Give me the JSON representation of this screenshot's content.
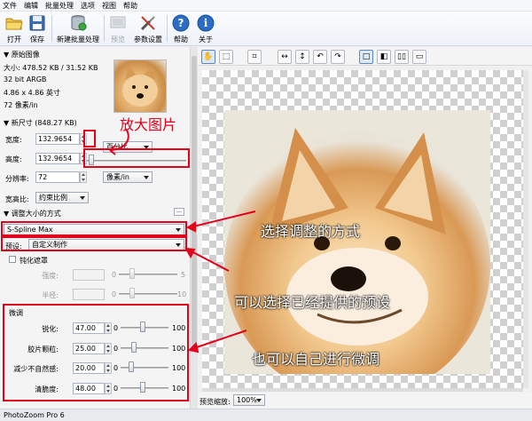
{
  "menu": [
    "文件",
    "编辑",
    "批量处理",
    "选项",
    "视图",
    "帮助"
  ],
  "toolbar": {
    "open": "打开",
    "save": "保存",
    "new_batch": "新建批量处理",
    "preview": "预览",
    "params": "参数设置",
    "help": "帮助",
    "about": "关于"
  },
  "original": {
    "header": "▼ 原始图像",
    "size": "大小: 478.52 KB / 31.52 KB",
    "bits": "32 bit ARGB",
    "dims": "4.86 x 4.86 英寸",
    "res": "72 像素/in"
  },
  "new_size": {
    "header": "▼ 新尺寸 (848.27 KB)",
    "width_label": "宽度:",
    "width_value": "132.9654",
    "height_label": "高度:",
    "height_value": "132.9654",
    "unit_label": "百分比",
    "res_label": "分辨率:",
    "res_value": "72",
    "res_unit": "像素/in",
    "aspect_label": "宽高比:",
    "aspect_value": "约束比例"
  },
  "resize": {
    "header": "▼ 调整大小的方式",
    "method": "S-Spline Max",
    "preset_label": "预设:",
    "preset_value": "自定义制作",
    "unsharp_label": "钝化遮罩",
    "strength_label": "强度:",
    "strength_min": "0",
    "strength_max": "5",
    "radius_label": "半径:",
    "radius_min": "0",
    "radius_max": "10"
  },
  "finetune": {
    "header": "微调",
    "rows": [
      {
        "label": "锐化:",
        "value": "47.00",
        "min": "0",
        "max": "100",
        "pct": 0.47
      },
      {
        "label": "胶片颗粒:",
        "value": "25.00",
        "min": "0",
        "max": "100",
        "pct": 0.25
      },
      {
        "label": "减少不自然感:",
        "value": "20.00",
        "min": "0",
        "max": "100",
        "pct": 0.2
      },
      {
        "label": "清脆度:",
        "value": "48.00",
        "min": "0",
        "max": "100",
        "pct": 0.48
      }
    ]
  },
  "annotations": {
    "enlarge": "放大图片",
    "choose_method": "选择调整的方式",
    "choose_preset": "可以选择已经提供的预设",
    "finetune": "也可以自己进行微调"
  },
  "preview": {
    "zoom_label": "预览缩放:",
    "zoom_value": "100%"
  },
  "status": "PhotoZoom Pro 6",
  "colors": {
    "annotation": "#e3001b",
    "accent": "#2b6cc4"
  }
}
